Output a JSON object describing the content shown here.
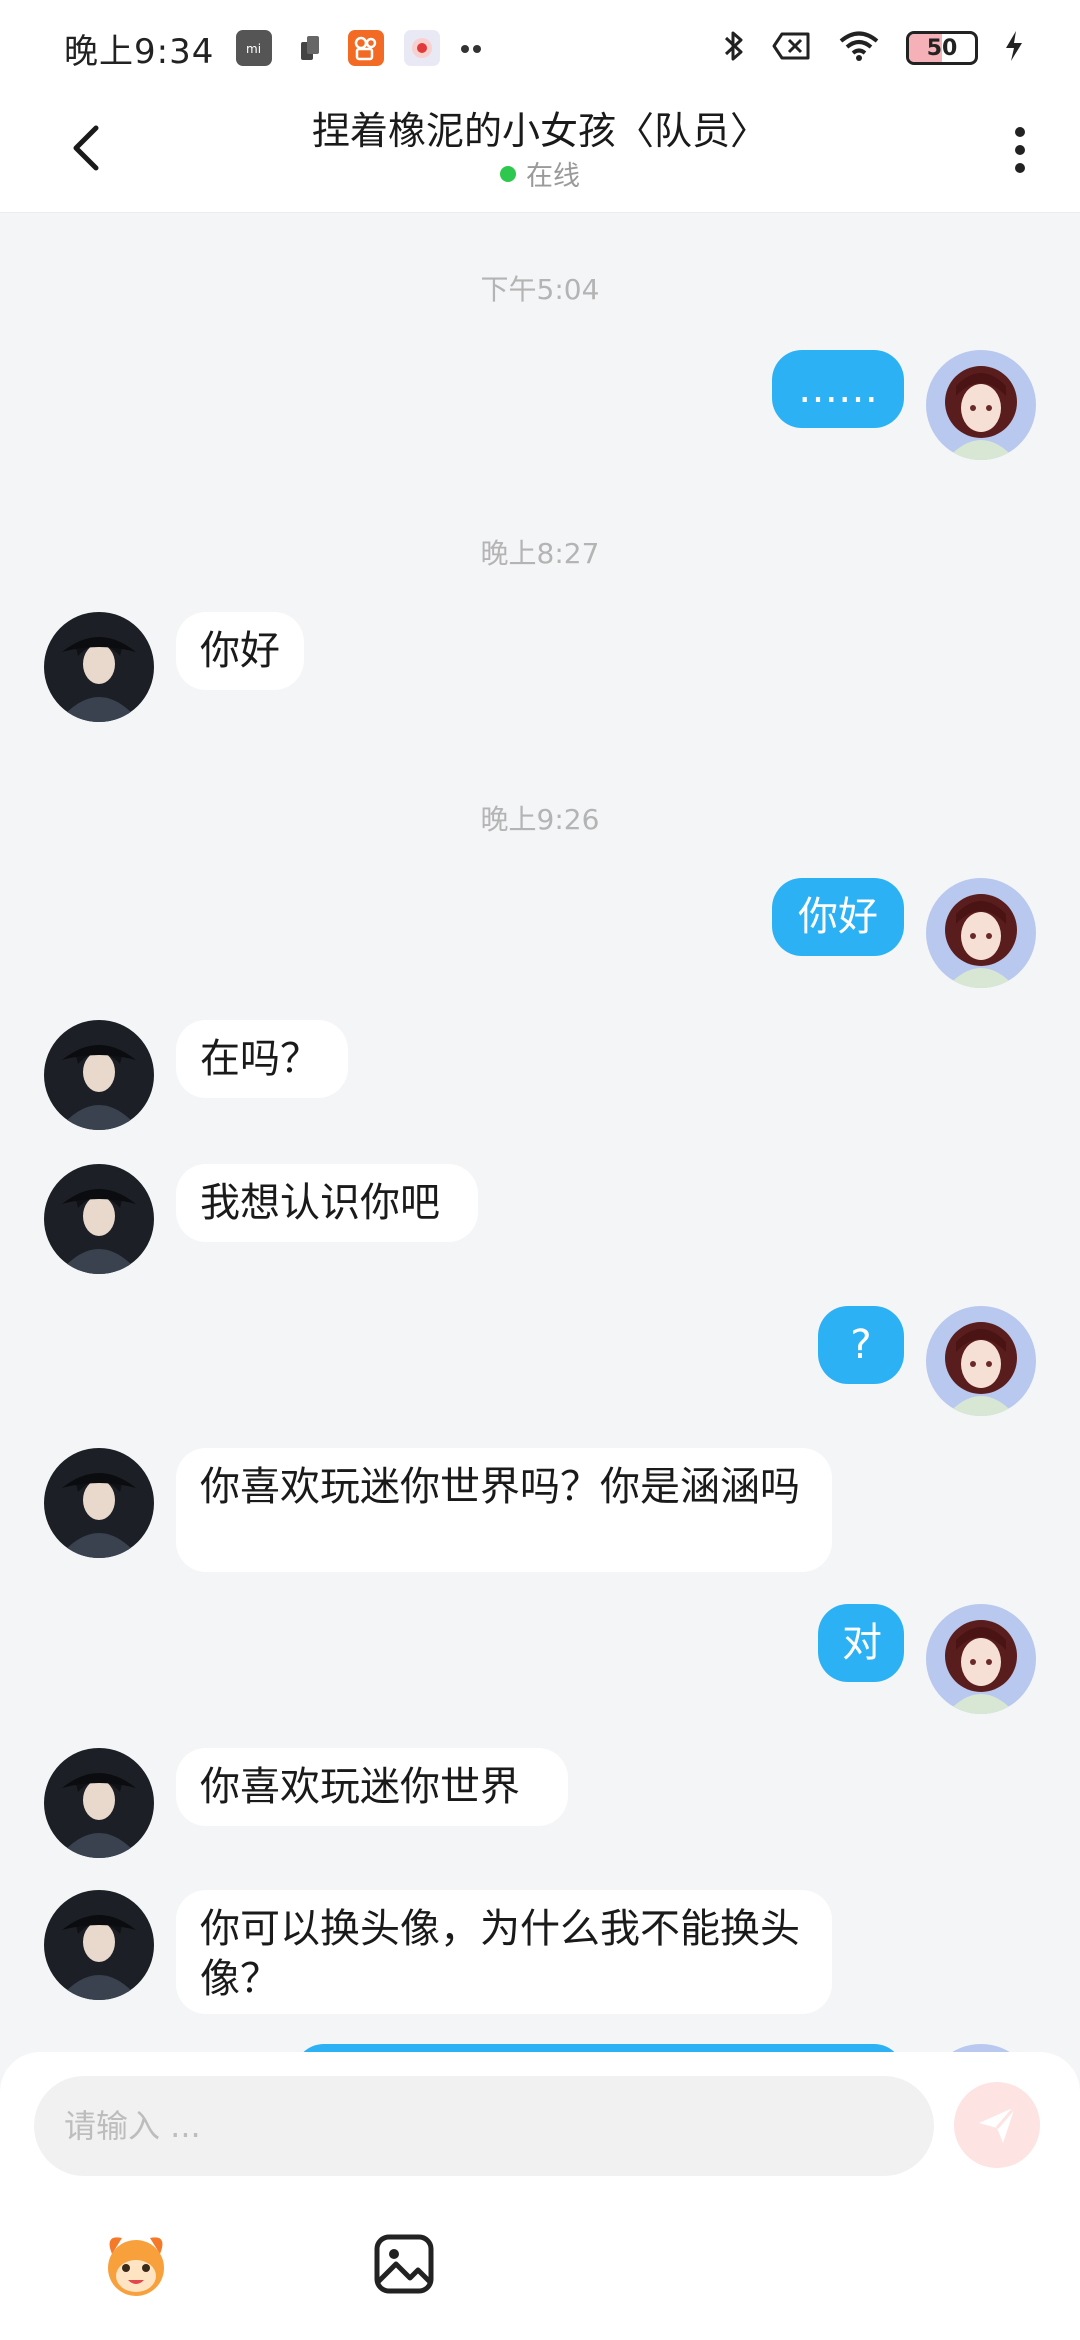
{
  "status_bar": {
    "time": "晚上9:34",
    "battery": "50",
    "battery_level_percent": 50,
    "icons_left": [
      "mi-icon",
      "sim-icon",
      "kuaishou-icon",
      "record-icon",
      "more-dots-icon"
    ],
    "icons_right": [
      "bluetooth-icon",
      "no-sim-icon",
      "wifi-icon",
      "battery-icon",
      "charging-icon"
    ]
  },
  "header": {
    "title": "捏着橡泥的小女孩〈队员〉",
    "status": "在线",
    "status_color": "#2dc84d"
  },
  "colors": {
    "outgoing_bubble": "#2db1f5",
    "incoming_bubble": "#ffffff",
    "background": "#f4f5f7"
  },
  "timestamps": [
    "下午5:04",
    "晚上8:27",
    "晚上9:26"
  ],
  "messages": [
    {
      "from": "me",
      "text": "……"
    },
    {
      "from": "other",
      "text": "你好"
    },
    {
      "from": "me",
      "text": "你好"
    },
    {
      "from": "other",
      "text": "在吗？"
    },
    {
      "from": "other",
      "text": "我想认识你吧"
    },
    {
      "from": "me",
      "text": "?"
    },
    {
      "from": "other",
      "text": "你喜欢玩迷你世界吗？你是涵涵吗"
    },
    {
      "from": "me",
      "text": "对"
    },
    {
      "from": "other",
      "text": "你喜欢玩迷你世界"
    },
    {
      "from": "other",
      "text": "你可以换头像，为什么我不能换头像？"
    }
  ],
  "composer": {
    "placeholder": "请输入 ...",
    "value": "",
    "tools": [
      "mascot-emoji-icon",
      "image-icon"
    ]
  }
}
